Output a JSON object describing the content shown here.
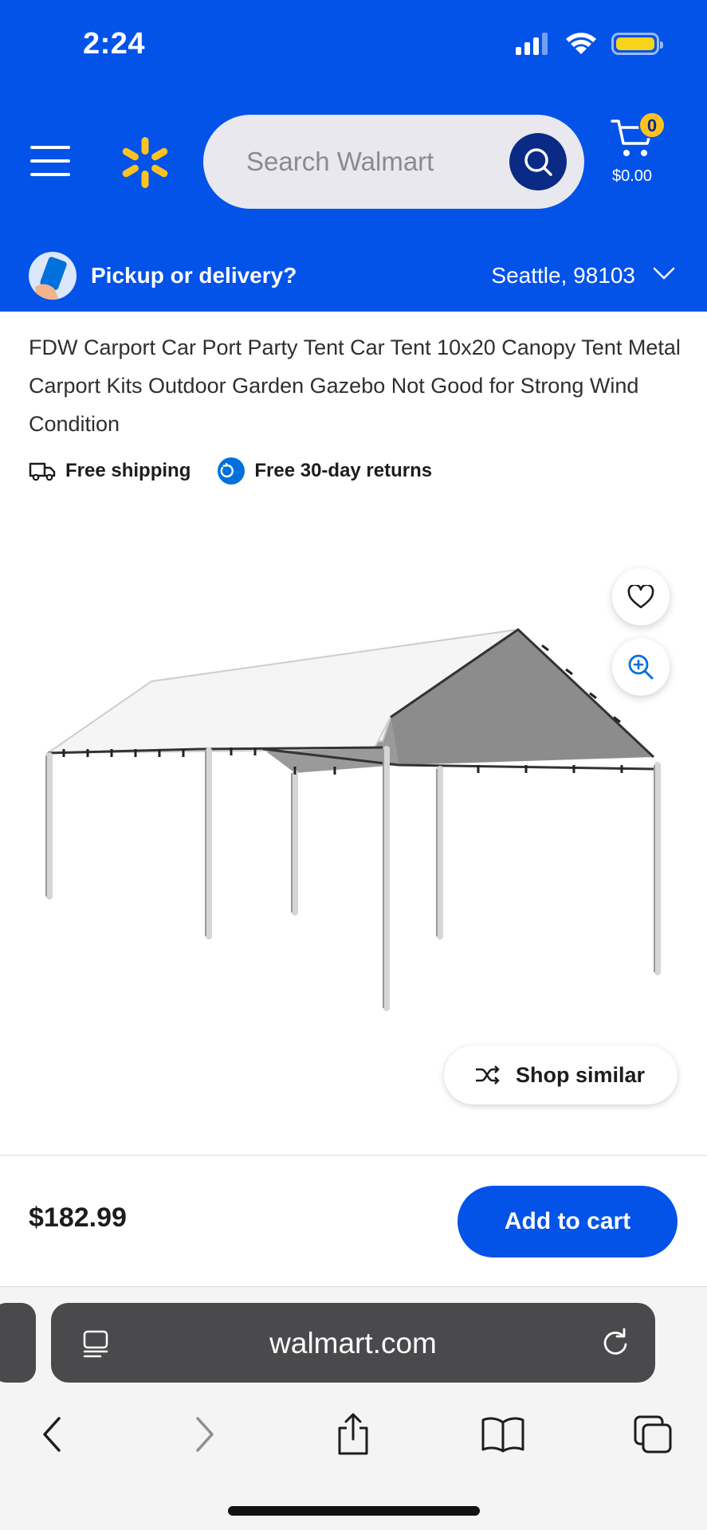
{
  "status_bar": {
    "time": "2:24"
  },
  "header": {
    "search_placeholder": "Search Walmart",
    "cart_count": "0",
    "cart_total": "$0.00",
    "accent_color": "#0353e9",
    "spark_color": "#ffc220"
  },
  "pickup": {
    "label": "Pickup or delivery?",
    "location": "Seattle, 98103"
  },
  "product": {
    "title": "FDW Carport Car Port Party Tent Car Tent 10x20 Canopy Tent Metal Carport Kits Outdoor Garden Gazebo Not Good for Strong Wind Condition",
    "badges": [
      "Free shipping",
      "Free 30-day returns"
    ],
    "image_icon": "carport-canopy-image",
    "shop_similar_label": "Shop similar",
    "price": "$182.99",
    "add_to_cart_label": "Add to cart"
  },
  "browser": {
    "url": "walmart.com",
    "nav_icons": [
      "back-icon",
      "forward-icon",
      "share-icon",
      "bookmarks-icon",
      "tabs-icon"
    ]
  }
}
